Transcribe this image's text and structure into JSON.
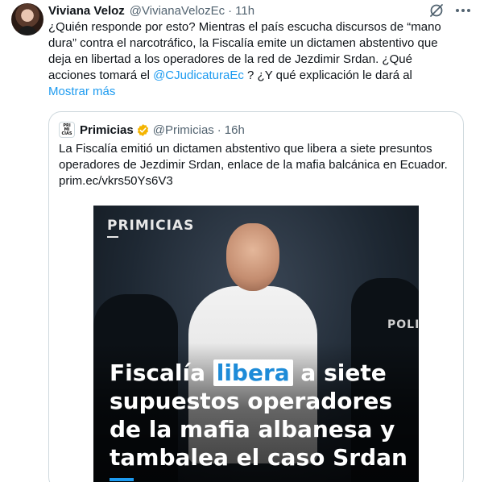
{
  "tweet": {
    "author_name": "Viviana Veloz",
    "handle": "@VivianaVelozEc",
    "separator": "·",
    "time": "11h",
    "text_lines": [
      "¿Quién responde por esto? Mientras el país escucha discursos de “mano",
      "dura” contra el narcotráfico, la Fiscalía emite un dictamen abstentivo que",
      "deja en libertad a los operadores de la red de Jezdimir Srdan. ¿Qué"
    ],
    "line4_before": "acciones tomará el ",
    "mention": "@CJudicaturaEc",
    "line4_after": " ? ¿Y qué explicación le dará al",
    "show_more": "Mostrar más",
    "icons": {
      "top_right_1": "grok-slash-circle-icon",
      "top_right_2": "more-horizontal-icon"
    }
  },
  "quote": {
    "logo_text_top": "PRI",
    "logo_text_mid": "MI",
    "logo_text_bot": "CIAS",
    "name": "Primicias",
    "verified_icon": "verified-badge-icon",
    "verified_color": "#f4b400",
    "handle": "@Primicias",
    "separator": "·",
    "time": "16h",
    "text_lines": [
      "La Fiscalía emitió un dictamen abstentivo que libera a siete presuntos",
      "operadores de Jezdimir Srdan, enlace de la mafia balcánica en Ecuador.",
      "prim.ec/vkrs50Ys6V3"
    ],
    "media": {
      "brand": "PRIMICIAS",
      "policia_text": "POLICÍ",
      "headline_l1_before": "Fiscalía ",
      "headline_l1_highlight": "libera",
      "headline_l1_after": " a siete",
      "headline_l2": "supuestos operadores",
      "headline_l3": "de la mafia albanesa y",
      "headline_l4": "tambalea el caso Srdan"
    }
  },
  "colors": {
    "text": "#0f1419",
    "secondary": "#536471",
    "link": "#1d9bf0",
    "border": "#cfd9de"
  }
}
